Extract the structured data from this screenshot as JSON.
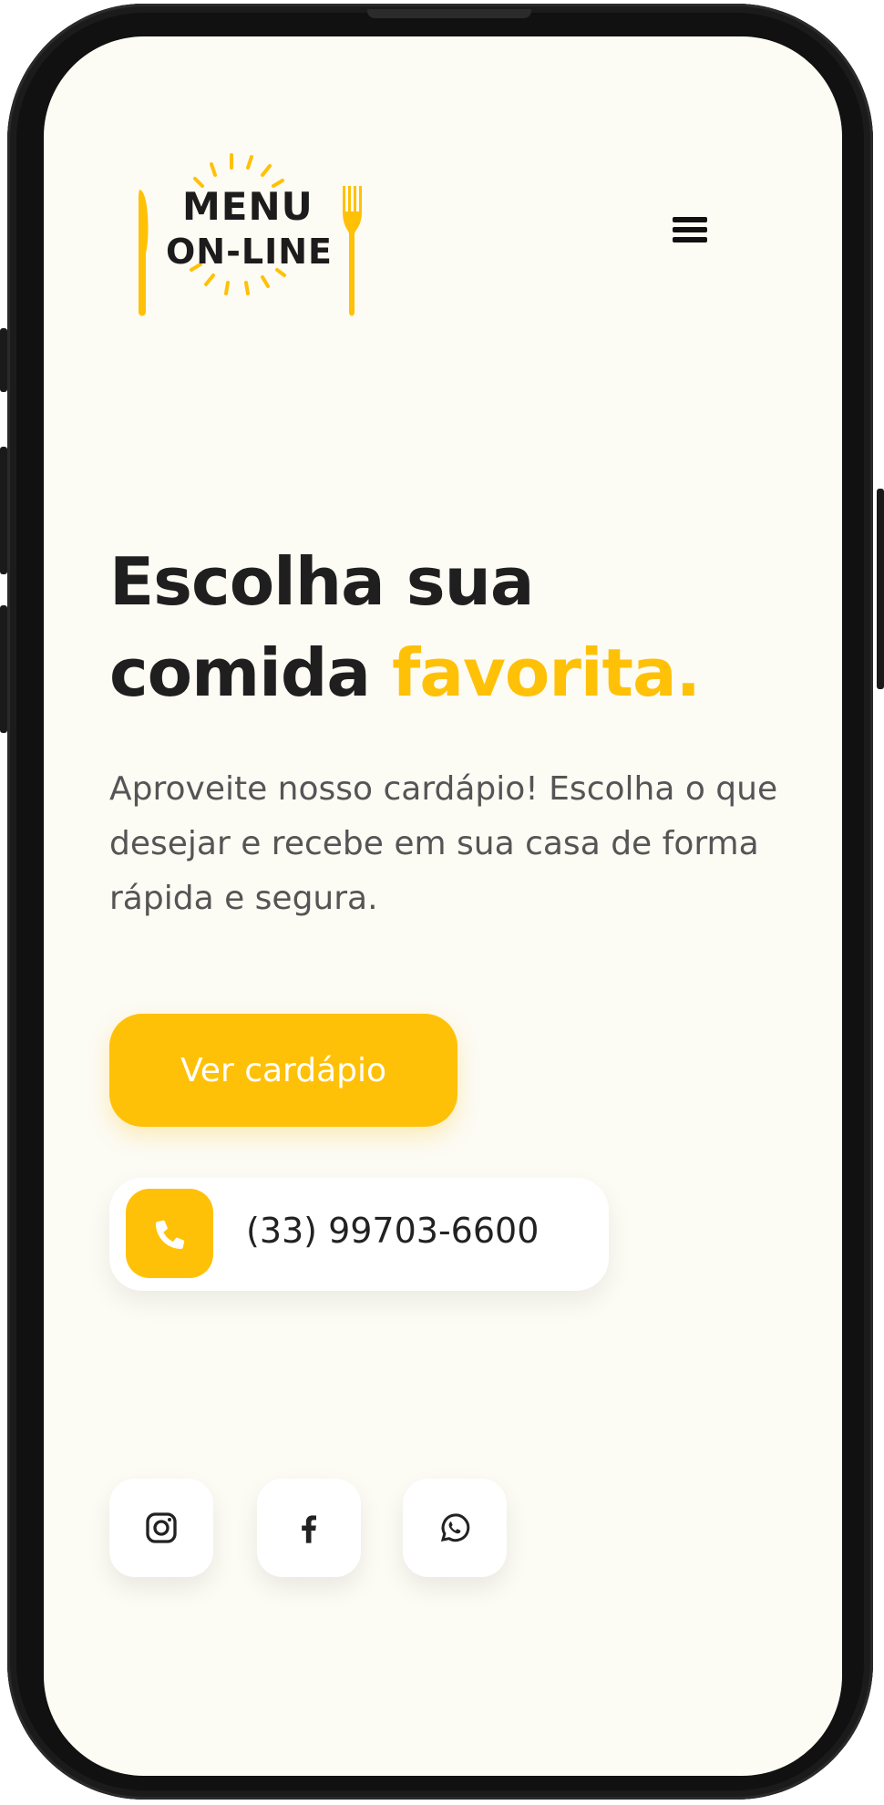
{
  "brand": {
    "logo_line1": "MENU",
    "logo_line2": "ON-LINE",
    "accent_color": "#ffc107"
  },
  "header": {
    "menu_icon": "hamburger-menu-icon"
  },
  "hero": {
    "title_part1": "Escolha sua",
    "title_part2": "comida",
    "title_accent": "favorita.",
    "description": "Aproveite nosso cardápio! Escolha o que desejar e recebe em sua casa de forma rápida e segura."
  },
  "cta": {
    "label": "Ver cardápio"
  },
  "contact": {
    "icon": "phone-icon",
    "phone": "(33) 99703-6600"
  },
  "socials": [
    {
      "icon": "instagram-icon"
    },
    {
      "icon": "facebook-icon"
    },
    {
      "icon": "whatsapp-icon"
    }
  ]
}
